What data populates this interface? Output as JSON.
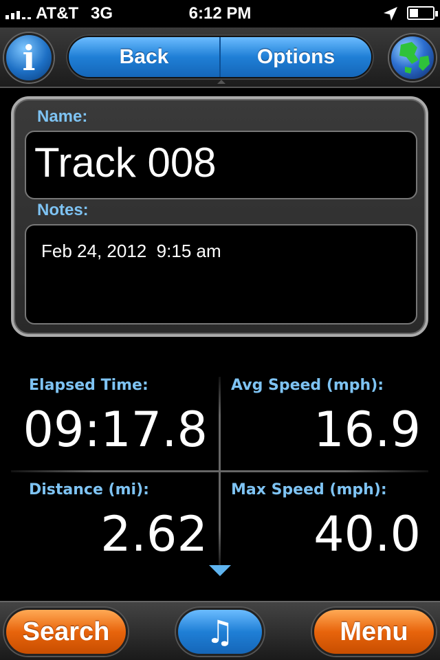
{
  "status_bar": {
    "carrier": "AT&T",
    "network": "3G",
    "time": "6:12 PM",
    "location_icon": "location-arrow-icon",
    "battery_icon": "battery-icon"
  },
  "nav": {
    "info_icon": "info-icon",
    "info_glyph": "i",
    "back_label": "Back",
    "options_label": "Options",
    "globe_icon": "globe-icon"
  },
  "track": {
    "name_label": "Name:",
    "name": "Track 008",
    "notes_label": "Notes:",
    "notes": "Feb 24, 2012  9:15 am"
  },
  "stats": {
    "elapsed_label": "Elapsed Time:",
    "elapsed_value": "09:17.8",
    "avg_speed_label": "Avg Speed (mph):",
    "avg_speed_value": "16.9",
    "distance_label": "Distance (mi):",
    "distance_value": "2.62",
    "max_speed_label": "Max Speed (mph):",
    "max_speed_value": "40.0"
  },
  "toolbar": {
    "search_label": "Search",
    "music_icon": "music-note-icon",
    "music_glyph": "♫",
    "menu_label": "Menu"
  },
  "colors": {
    "accent_blue": "#1f7fd6",
    "label_blue": "#7ec3f3",
    "accent_orange": "#e8640c"
  }
}
